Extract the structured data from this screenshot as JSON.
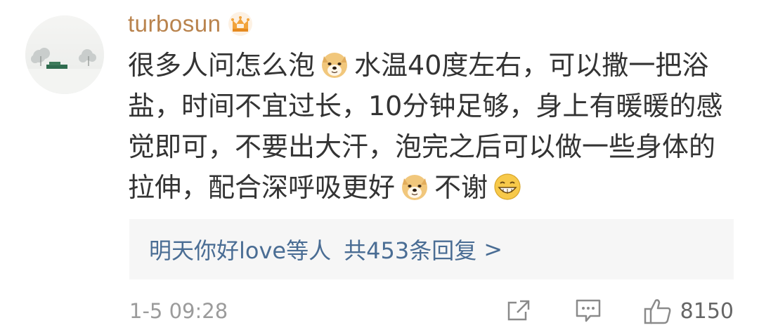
{
  "comment": {
    "username": "turbosun",
    "badge_icon": "crown-badge-icon",
    "text_parts": [
      "很多人问怎么泡",
      "水温40度左右，可以撒一把浴盐，时间不宜过长，10分钟足够，身上有暖暖的感觉即可，不要出大汗，泡完之后可以做一些身体的拉伸，配合深呼吸更好",
      "不谢"
    ],
    "emojis": [
      "doge-emoji-icon",
      "doge-emoji-icon",
      "grin-emoji-icon"
    ]
  },
  "replies": {
    "preview": "明天你好love等人",
    "count_label": "共453条回复",
    "chevron": ">"
  },
  "footer": {
    "timestamp": "1-5 09:28",
    "like_count": "8150",
    "icons": [
      "share-icon",
      "comment-icon",
      "like-icon"
    ]
  },
  "colors": {
    "username": "#b9834d",
    "reply_link": "#4a6d94",
    "reply_bg": "#f6f6f6",
    "meta": "#9b9b9b"
  }
}
